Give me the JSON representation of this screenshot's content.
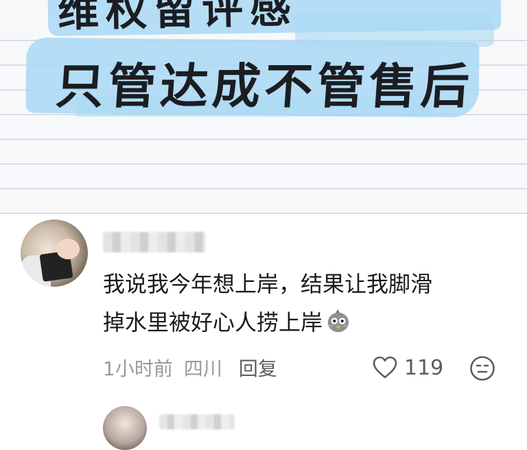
{
  "header_image": {
    "line_1": "维权留评感",
    "line_2": "只管达成不管售后",
    "highlight_color": "#a9d8f3"
  },
  "comment": {
    "avatar": "user-avatar",
    "text_line_1": "我说我今年想上岸，结果让我脚滑",
    "text_line_2": "掉水里被好心人捞上岸",
    "emoji": "surprised-chick-emoji",
    "time": "1小时前",
    "location": "四川",
    "reply_label": "回复",
    "like_count": "119",
    "like_icon": "heart-outline-icon",
    "dislike_icon": "meh-face-icon"
  },
  "next_comment": {
    "avatar": "user-avatar"
  }
}
